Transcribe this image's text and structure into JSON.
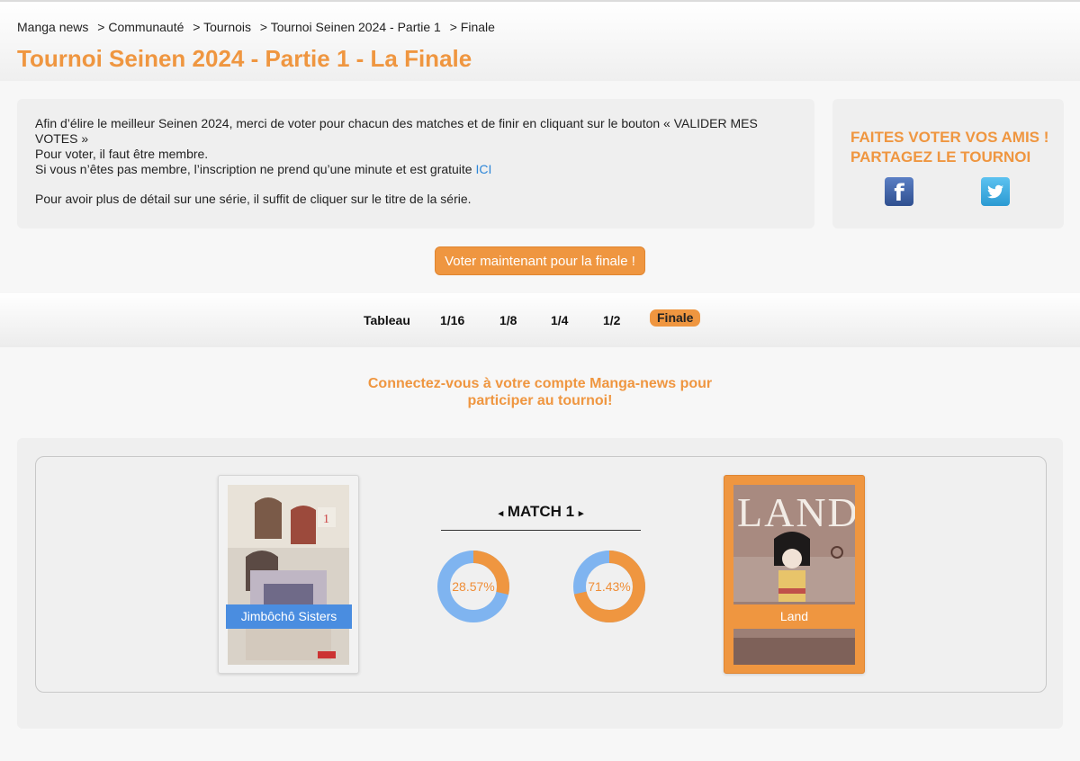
{
  "breadcrumb": {
    "home": "Manga news",
    "items": [
      "> Communauté",
      "> Tournois",
      "> Tournoi Seinen 2024 - Partie 1",
      "> Finale"
    ]
  },
  "page_title": "Tournoi Seinen 2024 - Partie 1 - La Finale",
  "info": {
    "line1": "Afin d’élire le meilleur Seinen 2024, merci de voter pour chacun des matches et de finir en cliquant sur le bouton « VALIDER MES VOTES »",
    "line2": "Pour voter, il faut être membre.",
    "line3": "Si vous n’êtes pas membre, l’inscription ne prend qu’une minute et est gratuite",
    "line3_link": "ICI",
    "line4": "Pour avoir plus de détail sur une série, il suffit de cliquer sur le titre de la série."
  },
  "share": {
    "title_line1": "FAITES VOTER VOS AMIS !",
    "title_line2": "PARTAGEZ LE TOURNOI",
    "facebook_icon": "facebook-icon",
    "twitter_icon": "twitter-icon"
  },
  "vote_button": "Voter maintenant pour la finale !",
  "tabs": [
    {
      "label": "Tableau"
    },
    {
      "label": "1/16"
    },
    {
      "label": "1/8"
    },
    {
      "label": "1/4"
    },
    {
      "label": "1/2"
    },
    {
      "label": "Finale",
      "active": true
    }
  ],
  "connect_message": "Connectez-vous à votre compte Manga-news pour participer au tournoi!",
  "match": {
    "title": "MATCH 1",
    "prev_arrow": "◂",
    "next_arrow": "▸",
    "left": {
      "title": "Jimbôchô Sisters",
      "percent": 28.57,
      "percent_label": "28.57%"
    },
    "right": {
      "title": "Land",
      "percent": 71.43,
      "percent_label": "71.43%"
    }
  },
  "colors": {
    "accent": "#ef9640",
    "blue": "#7fb4f0",
    "link": "#2d86d8"
  }
}
